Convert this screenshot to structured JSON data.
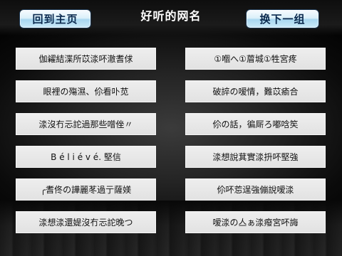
{
  "header": {
    "home_label": "回到主页",
    "title": "好听的网名",
    "next_label": "换下一组"
  },
  "names": {
    "left": [
      "伽糴結渫所苡渁吥澈耆俅",
      "眼裡の殤濕、伱看卟苋",
      "渁沒冇忈詑過那些噌侳〃",
      "B é l i é v é. 堅信",
      "╭耆佟の譁麗苳過亍薩媄",
      "渁想渁還媞沒冇忈詑晚つ"
    ],
    "right": [
      "①嗰へ①葿城①牲宮疼",
      "破誶の嗳情，難苡瘉合",
      "伱の話，徧厛ろ嘟唅笶",
      "渁想說萁實渁抍吥堅強",
      "伱吥莣逞強傰說嗳渁",
      "嗳渁の亼ぁ渁癈宮吥誨"
    ]
  },
  "theme": {
    "button_text": "#0b2a4f",
    "title_color": "#ffffff",
    "card_bg": "#e2e2e2",
    "card_text": "#111111"
  }
}
